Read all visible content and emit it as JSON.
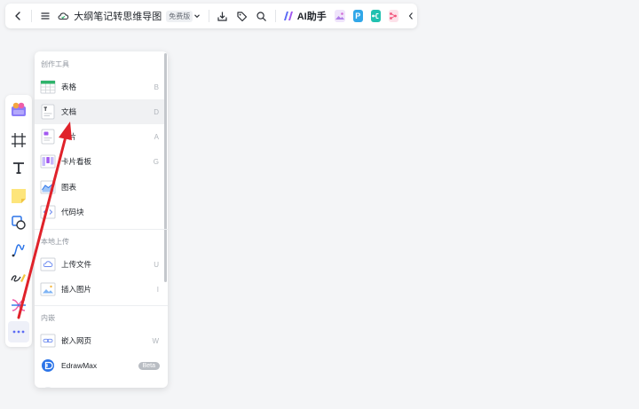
{
  "topbar": {
    "title": "大纲笔记转思维导图",
    "plan_badge": "免费版",
    "ai_label": "AI助手",
    "app_p_label": "P"
  },
  "menu": {
    "sections": [
      {
        "title": "创作工具",
        "items": [
          {
            "label": "表格",
            "key": "B"
          },
          {
            "label": "文档",
            "key": "D"
          },
          {
            "label": "卡片",
            "key": "A"
          },
          {
            "label": "卡片看板",
            "key": "G"
          },
          {
            "label": "图表",
            "key": ""
          },
          {
            "label": "代码块",
            "key": ""
          }
        ]
      },
      {
        "title": "本地上传",
        "items": [
          {
            "label": "上传文件",
            "key": "U"
          },
          {
            "label": "插入图片",
            "key": "I"
          }
        ]
      },
      {
        "title": "内嵌",
        "items": [
          {
            "label": "嵌入网页",
            "key": "W"
          },
          {
            "label": "EdrawMax",
            "badge": "Beta"
          }
        ]
      }
    ]
  },
  "colors": {
    "accent": "#5b6bf5",
    "annotation_arrow": "#e0222a",
    "table_green": "#2fb36b",
    "edraw_blue": "#2b74e8"
  },
  "icons": {
    "topbar": [
      "back-icon",
      "menu-icon",
      "cloud-icon",
      "chevron-down-icon",
      "download-icon",
      "tag-icon",
      "search-icon",
      "ai-assistant-icon",
      "image-app-icon",
      "p-app-icon",
      "flow-app-icon",
      "mind-app-icon",
      "chevron-left-icon"
    ],
    "toolbar": [
      "templates-icon",
      "frame-icon",
      "text-icon",
      "sticky-note-icon",
      "shape-icon",
      "connector-icon",
      "pen-icon",
      "mindmap-icon",
      "more-icon"
    ]
  }
}
